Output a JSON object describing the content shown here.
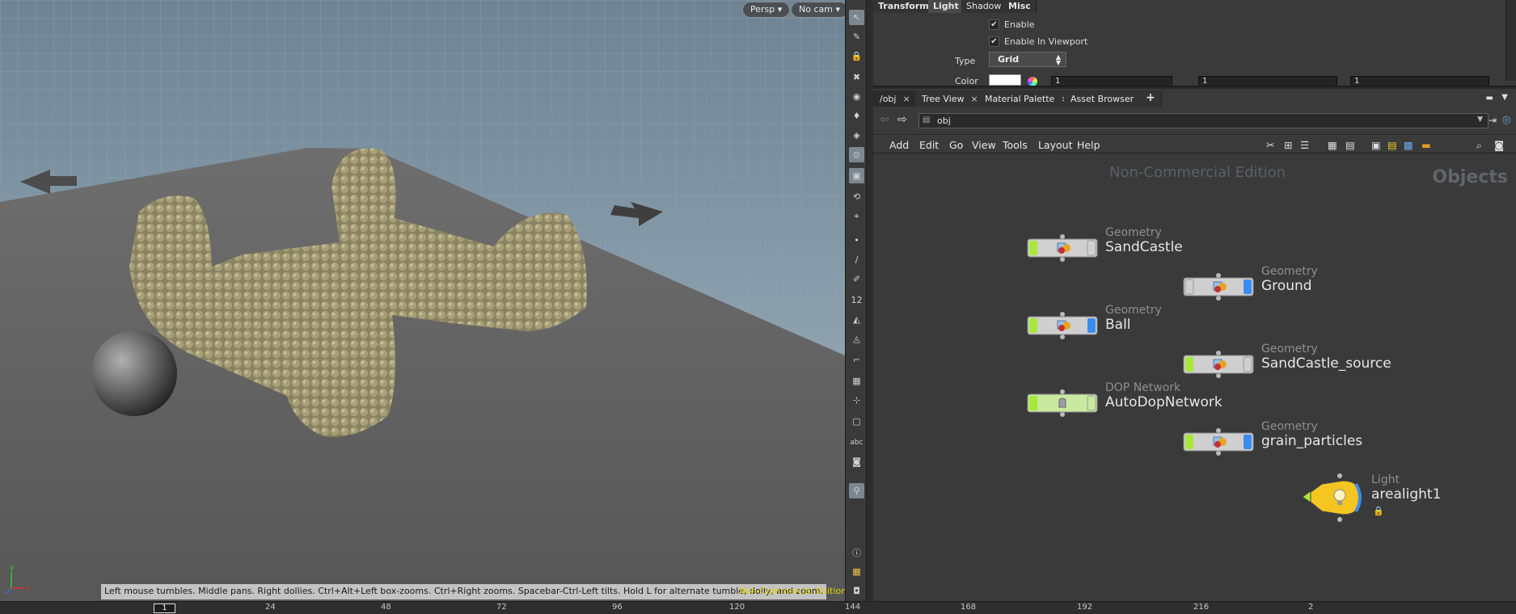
{
  "viewport": {
    "cam_buttons": [
      "Persp",
      "No cam"
    ],
    "status_hint": "Left mouse tumbles. Middle pans. Right dollies. Ctrl+Alt+Left box-zooms. Ctrl+Right zooms. Spacebar-Ctrl-Left tilts. Hold L for alternate tumble, dolly, and zoom.",
    "edition_notice": "Non-Commercial Edition",
    "axis_labels": {
      "x": "x",
      "y": "y"
    }
  },
  "toolshelf": {
    "text_tools": [
      "12",
      "abc"
    ],
    "icons": [
      "select-icon",
      "pose-icon",
      "lock-icon",
      "snap-icon",
      "camera-icon",
      "light-icon",
      "bulb-icon",
      "handle-icon",
      "view-icon",
      "tumble-icon",
      "target-icon",
      "point-icon",
      "brush-icon",
      "pen-icon",
      "number-icon",
      "paint-icon",
      "sculpt-icon",
      "corner-icon",
      "grid-icon",
      "bone-icon",
      "frame-icon",
      "text-icon",
      "shade-icon",
      "pin-icon",
      "info-icon",
      "display-icon",
      "camera-toggle-icon"
    ]
  },
  "params": {
    "tabs": [
      "Transform",
      "Light",
      "Shadow",
      "Misc"
    ],
    "enable_label": "Enable",
    "enable_viewport_label": "Enable In Viewport",
    "type_label": "Type",
    "type_value": "Grid",
    "color_label": "Color",
    "color_values": [
      "1",
      "1",
      "1"
    ]
  },
  "network": {
    "tabs": [
      "/obj",
      "Tree View",
      "Material Palette",
      "Asset Browser"
    ],
    "path": "obj",
    "menu": [
      "Add",
      "Edit",
      "Go",
      "View",
      "Tools",
      "Layout",
      "Help"
    ],
    "watermark": "Non-Commercial Edition",
    "context_label": "Objects",
    "nodes": [
      {
        "type": "Geometry",
        "name": "SandCastle"
      },
      {
        "type": "Geometry",
        "name": "Ground"
      },
      {
        "type": "Geometry",
        "name": "Ball"
      },
      {
        "type": "Geometry",
        "name": "SandCastle_source"
      },
      {
        "type": "DOP Network",
        "name": "AutoDopNetwork"
      },
      {
        "type": "Geometry",
        "name": "grain_particles"
      },
      {
        "type": "Light",
        "name": "arealight1"
      }
    ]
  },
  "timeline": {
    "current_frame": "1",
    "ticks": [
      "24",
      "48",
      "72",
      "96",
      "120",
      "144",
      "168",
      "192",
      "216",
      "2"
    ]
  },
  "colors": {
    "node_green": "#a8e83a",
    "node_blue": "#3b8cf0",
    "light_yellow": "#f5c521",
    "edition_yellow": "#e8d400"
  }
}
